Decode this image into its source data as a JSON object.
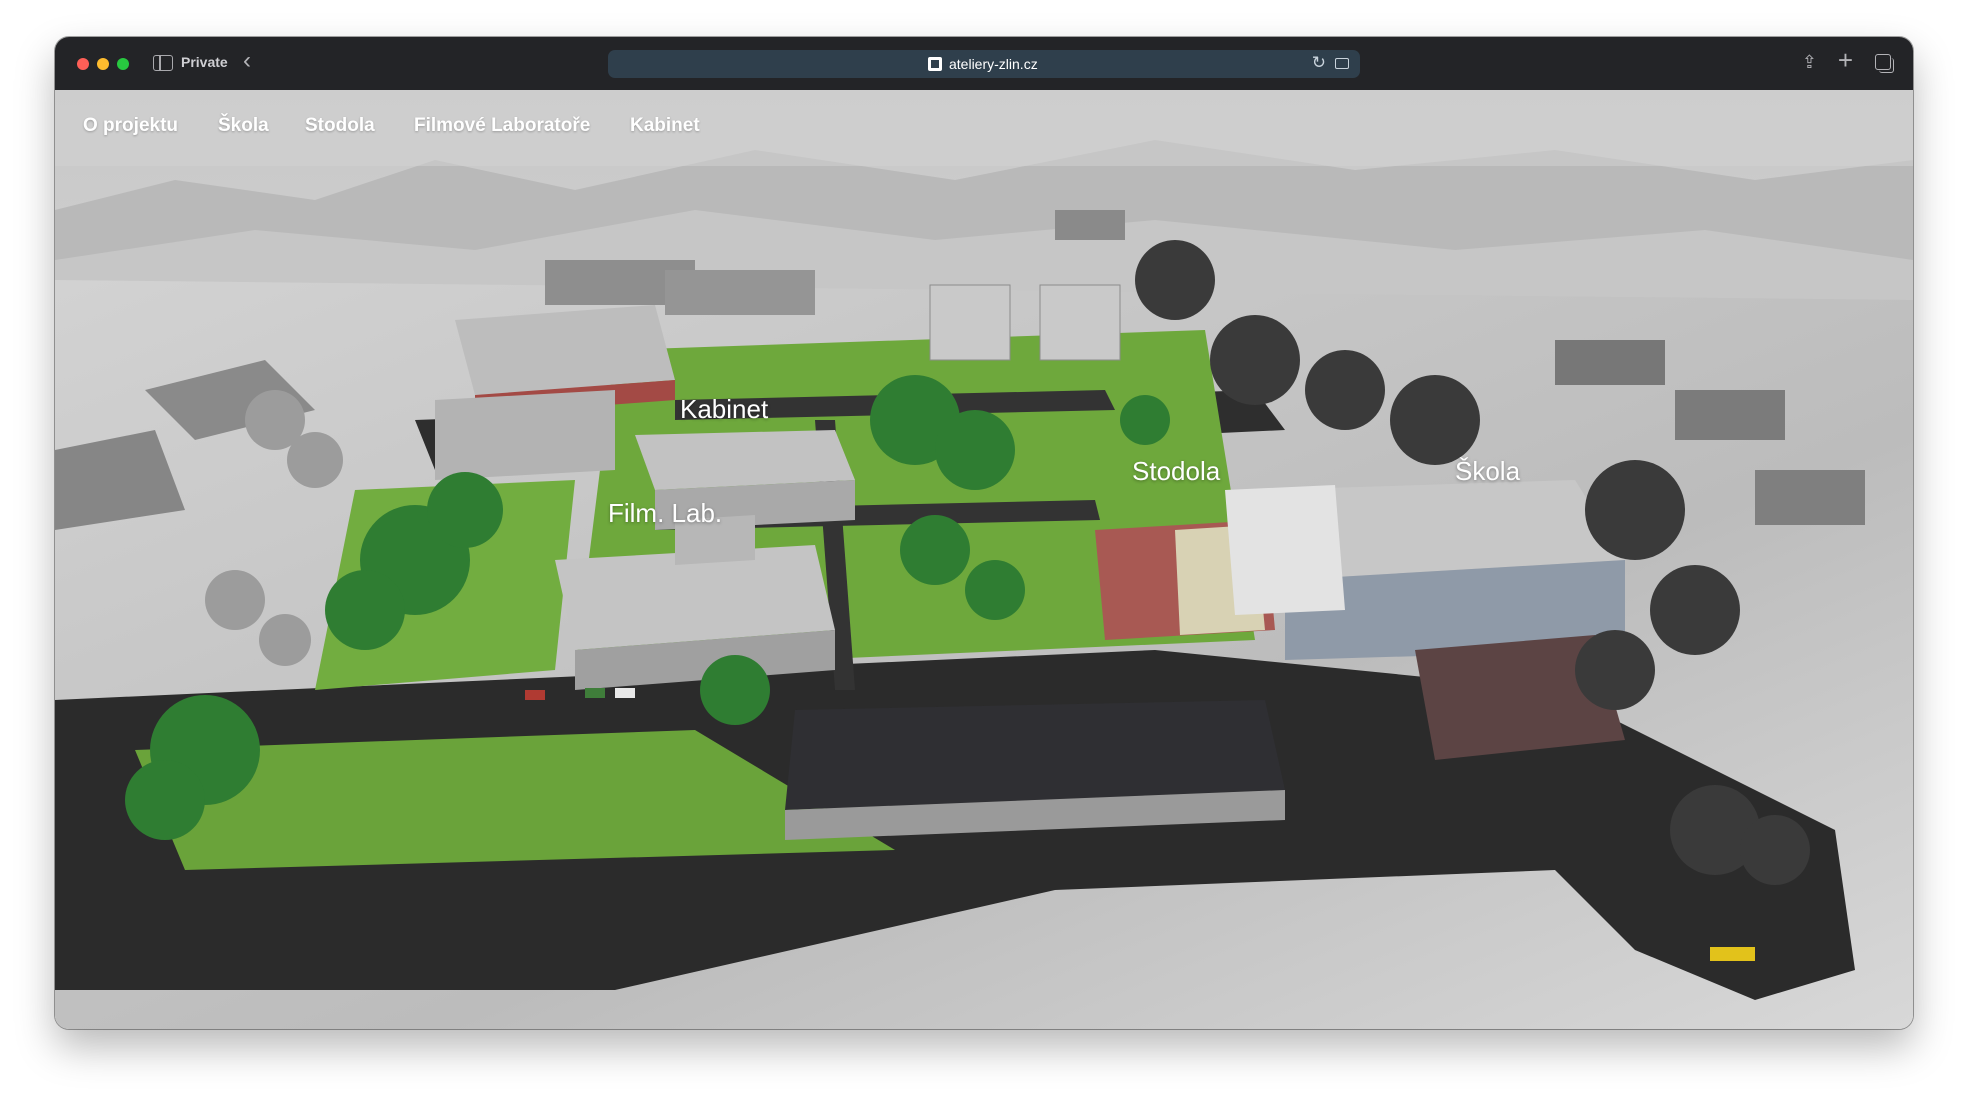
{
  "browser": {
    "mode_label": "Private",
    "url": "ateliery-zlin.cz"
  },
  "nav": {
    "items": [
      {
        "label": "O projektu"
      },
      {
        "label": "Škola"
      },
      {
        "label": "Stodola"
      },
      {
        "label": "Filmové Laboratoře"
      },
      {
        "label": "Kabinet"
      }
    ]
  },
  "map": {
    "labels": {
      "kabinet": "Kabinet",
      "film_lab": "Film. Lab.",
      "stodola": "Stodola",
      "skola": "Škola"
    }
  },
  "colors": {
    "grass": "#6aa33a",
    "road": "#2a2a2a",
    "building_roof": "#bdbdbd",
    "trees": "#2f7d32",
    "terrain": "#cfcfcf"
  }
}
